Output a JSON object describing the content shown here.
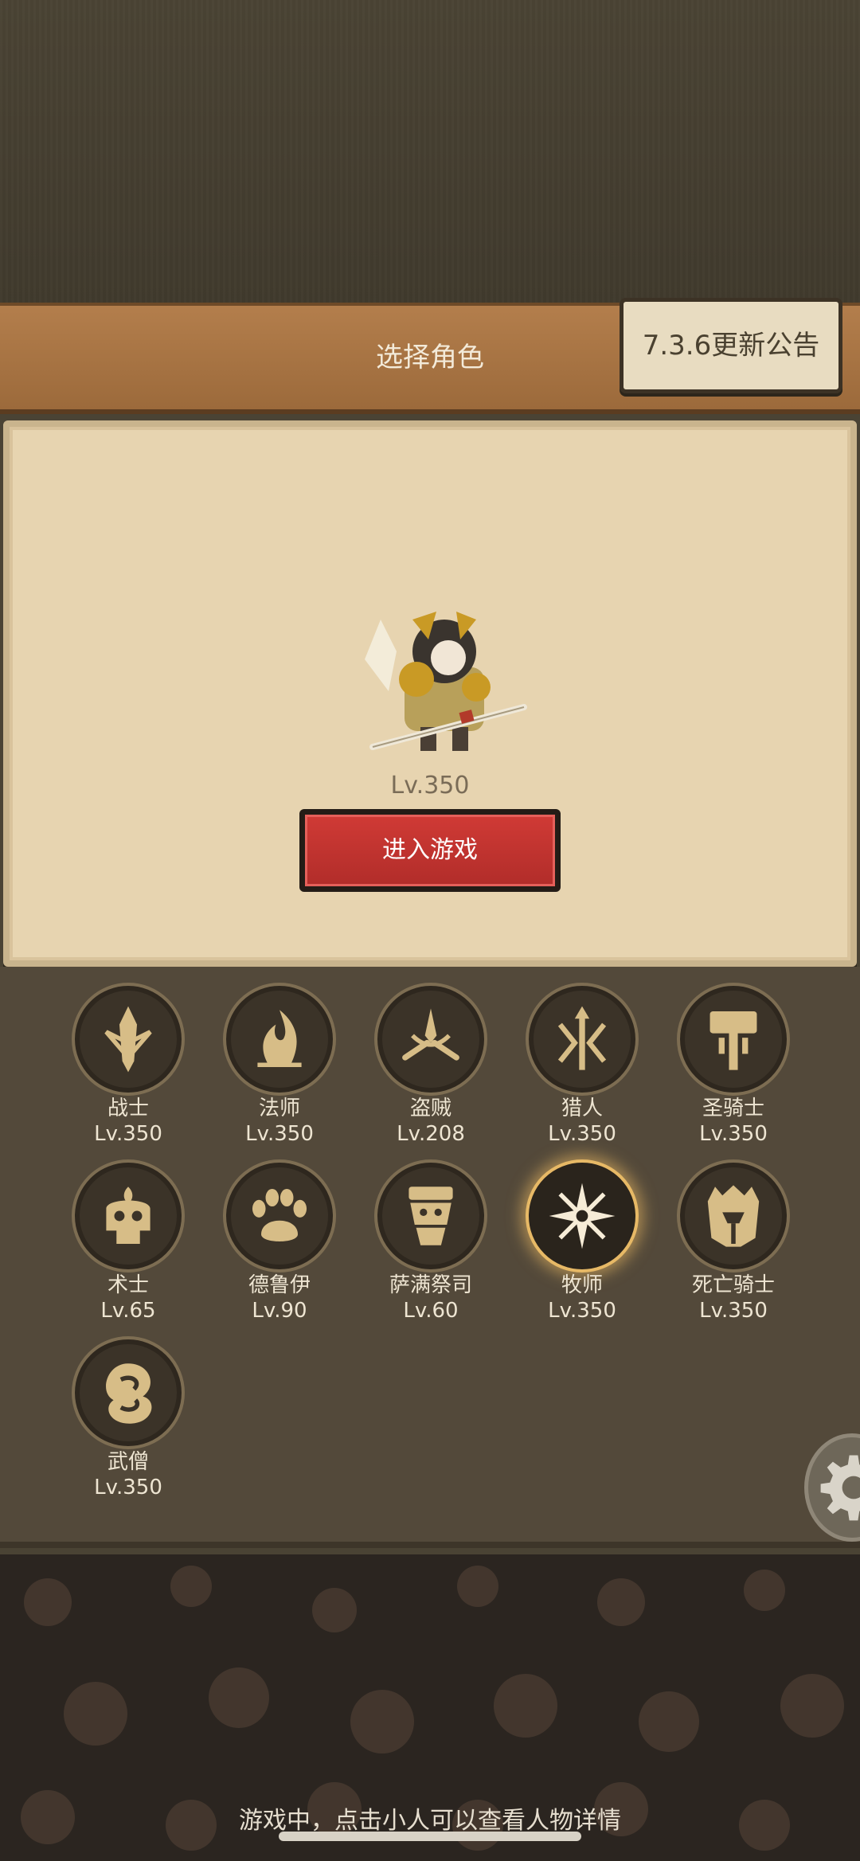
{
  "header": {
    "title": "选择角色",
    "notice_label": "7.3.6更新公告"
  },
  "hero": {
    "level": "Lv.350",
    "enter_label": "进入游戏"
  },
  "classes": [
    {
      "name": "战士",
      "level": "Lv.350",
      "icon": "warrior-sword-icon"
    },
    {
      "name": "法师",
      "level": "Lv.350",
      "icon": "mage-flame-icon"
    },
    {
      "name": "盗贼",
      "level": "Lv.208",
      "icon": "rogue-daggers-icon"
    },
    {
      "name": "猎人",
      "level": "Lv.350",
      "icon": "hunter-arrows-icon"
    },
    {
      "name": "圣骑士",
      "level": "Lv.350",
      "icon": "paladin-hammer-icon"
    },
    {
      "name": "术士",
      "level": "Lv.65",
      "icon": "warlock-skull-icon"
    },
    {
      "name": "德鲁伊",
      "level": "Lv.90",
      "icon": "druid-paw-icon"
    },
    {
      "name": "萨满祭司",
      "level": "Lv.60",
      "icon": "shaman-totem-icon"
    },
    {
      "name": "牧师",
      "level": "Lv.350",
      "icon": "priest-star-icon",
      "selected": true
    },
    {
      "name": "死亡骑士",
      "level": "Lv.350",
      "icon": "deathknight-helm-icon"
    },
    {
      "name": "武僧",
      "level": "Lv.350",
      "icon": "monk-swirl-icon"
    }
  ],
  "footer": {
    "hint": "游戏中，点击小人可以查看人物详情"
  },
  "colors": {
    "accent_gold": "#e7b966",
    "enter_red": "#c23331",
    "panel_parchment": "#e7d4b0"
  }
}
